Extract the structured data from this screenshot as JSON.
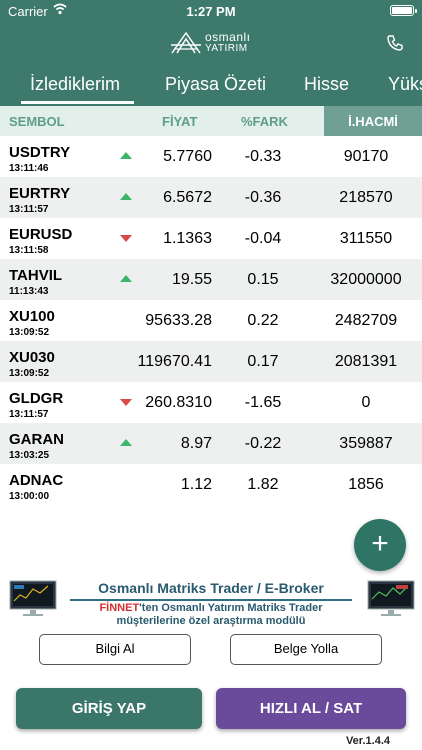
{
  "status_bar": {
    "carrier": "Carrier",
    "time": "1:27 PM"
  },
  "brand": {
    "line1": "osmanlı",
    "line2": "YATIRIM"
  },
  "tabs": [
    {
      "label": "İzlediklerim",
      "active": true
    },
    {
      "label": "Piyasa Özeti",
      "active": false
    },
    {
      "label": "Hisse",
      "active": false
    },
    {
      "label": "Yüks",
      "active": false
    }
  ],
  "columns": {
    "symbol": "SEMBOL",
    "price": "FİYAT",
    "change": "%FARK",
    "volume": "İ.HACMİ"
  },
  "rows": [
    {
      "symbol": "USDTRY",
      "time": "13:11:46",
      "trend": "up",
      "price": "5.7760",
      "change": "-0.33",
      "volume": "90170"
    },
    {
      "symbol": "EURTRY",
      "time": "13:11:57",
      "trend": "up",
      "price": "6.5672",
      "change": "-0.36",
      "volume": "218570"
    },
    {
      "symbol": "EURUSD",
      "time": "13:11:58",
      "trend": "down",
      "price": "1.1363",
      "change": "-0.04",
      "volume": "311550"
    },
    {
      "symbol": "TAHVIL",
      "time": "11:13:43",
      "trend": "up",
      "price": "19.55",
      "change": "0.15",
      "volume": "32000000"
    },
    {
      "symbol": "XU100",
      "time": "13:09:52",
      "trend": "none",
      "price": "95633.28",
      "change": "0.22",
      "volume": "2482709"
    },
    {
      "symbol": "XU030",
      "time": "13:09:52",
      "trend": "none",
      "price": "119670.41",
      "change": "0.17",
      "volume": "2081391"
    },
    {
      "symbol": "GLDGR",
      "time": "13:11:57",
      "trend": "down",
      "price": "260.8310",
      "change": "-1.65",
      "volume": "0"
    },
    {
      "symbol": "GARAN",
      "time": "13:03:25",
      "trend": "up",
      "price": "8.97",
      "change": "-0.22",
      "volume": "359887"
    },
    {
      "symbol": "ADNAC",
      "time": "13:00:00",
      "trend": "none",
      "price": "1.12",
      "change": "1.82",
      "volume": "1856"
    }
  ],
  "fab": {
    "label": "+"
  },
  "banner": {
    "title": "Osmanlı Matriks Trader / E-Broker",
    "sub_brand": "FİNNET",
    "sub1_rest": "'ten Osmanlı Yatırım Matriks Trader",
    "sub2": "müşterilerine özel araştırma modülü"
  },
  "buttons": {
    "info": "Bilgi Al",
    "send_doc": "Belge Yolla",
    "login": "GİRİŞ YAP",
    "quick_trade": "HIZLI AL / SAT"
  },
  "version": "Ver.1.4.4",
  "colors": {
    "header_bg": "#3d7a6c",
    "up": "#3db56a",
    "down": "#d94a4a",
    "login_btn": "#3a7769",
    "trade_btn": "#6a4a9a"
  },
  "icons": [
    "wifi-icon",
    "battery-icon",
    "logo-icon",
    "phone-icon",
    "arrow-up-icon",
    "arrow-down-icon",
    "plus-icon",
    "monitor-icon"
  ]
}
